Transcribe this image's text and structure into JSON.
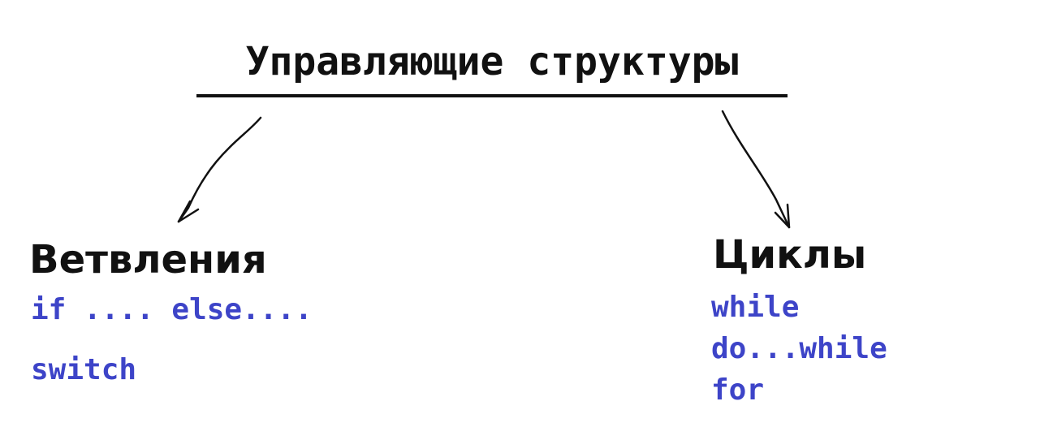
{
  "title": "Управляющие структуры",
  "branches": {
    "heading": "Ветвления",
    "items": [
      "if .... else....",
      "switch"
    ]
  },
  "loops": {
    "heading": "Циклы",
    "items": [
      "while",
      "do...while",
      "for"
    ]
  },
  "colors": {
    "text": "#111111",
    "code": "#3d44c8",
    "background": "#ffffff"
  }
}
